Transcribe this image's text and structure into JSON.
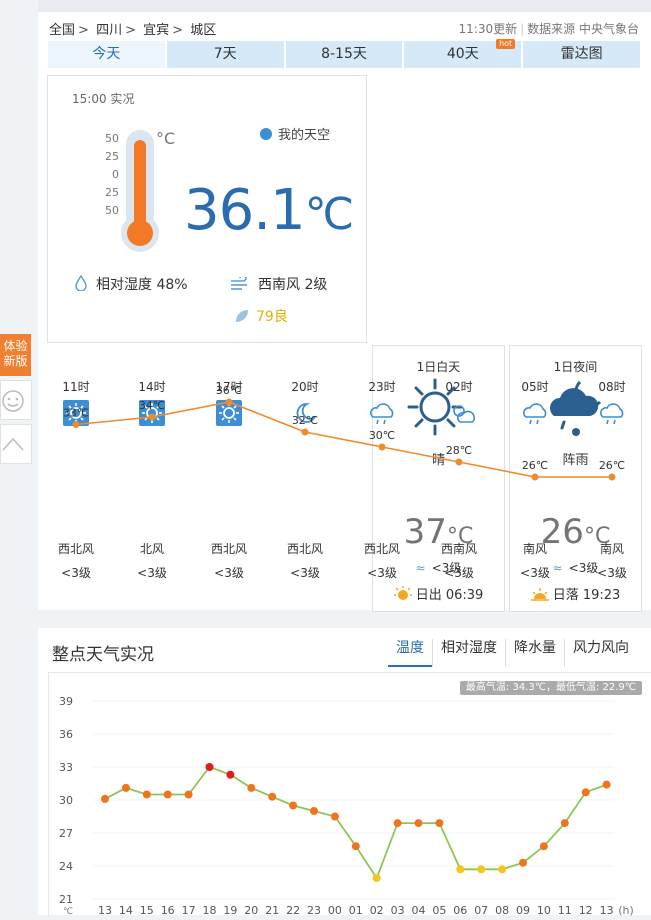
{
  "breadcrumb": [
    "全国",
    "四川",
    "宜宾",
    "城区"
  ],
  "update": {
    "time": "11:30更新",
    "source": "数据来源 中央气象台"
  },
  "tabs": [
    {
      "label": "今天",
      "active": true
    },
    {
      "label": "7天"
    },
    {
      "label": "8-15天"
    },
    {
      "label": "40天",
      "badge": "hot"
    },
    {
      "label": "雷达图"
    }
  ],
  "now": {
    "time": "15:00 实况",
    "my_sky": "我的天空",
    "temperature": "36.1",
    "unit": "℃",
    "therm_unit": "°C",
    "scale": [
      "50",
      "25",
      "0",
      "-25",
      "-50"
    ],
    "humidity": "相对湿度  48%",
    "wind": "西南风  2级",
    "aqi": "79良"
  },
  "hourly": {
    "hours": [
      "11时",
      "14时",
      "17时",
      "20时",
      "23时",
      "02时",
      "05时",
      "08时"
    ],
    "icons": [
      "sun-icon",
      "sun-icon",
      "sun-icon",
      "moon-icon",
      "cloud-rain-icon",
      "cloud-sun-icon",
      "cloud-rain-icon",
      "cloud-rain-icon"
    ],
    "temps": [
      33,
      34,
      36,
      32,
      30,
      28,
      26,
      26
    ],
    "temp_labels": [
      "33℃",
      "34℃",
      "36℃",
      "32℃",
      "30℃",
      "28℃",
      "26℃",
      "26℃"
    ],
    "winds": [
      "西北风",
      "北风",
      "西北风",
      "西北风",
      "西北风",
      "西南风",
      "南风",
      "南风"
    ],
    "levels": [
      "<3级",
      "<3级",
      "<3级",
      "<3级",
      "<3级",
      "<3级",
      "<3级",
      "<3级"
    ]
  },
  "day": {
    "heading": "1日白天",
    "condition": "晴",
    "temp": "37",
    "unit": "°C",
    "level": "<3级",
    "sun": "日出 06:39"
  },
  "night": {
    "heading": "1日夜间",
    "condition": "阵雨",
    "temp": "26",
    "unit": "°C",
    "level": "<3级",
    "sun": "日落 19:23"
  },
  "side": {
    "new_version": "体验新版"
  },
  "chart_section": {
    "title": "整点天气实况",
    "tabs": [
      "温度",
      "相对湿度",
      "降水量",
      "风力风向"
    ],
    "active_tab": "温度",
    "stats": "最高气温: 34.3℃，最低气温: 22.9℃"
  },
  "chart_data": {
    "type": "line",
    "x": [
      "13",
      "14",
      "15",
      "16",
      "17",
      "18",
      "19",
      "20",
      "21",
      "22",
      "23",
      "00",
      "01",
      "02",
      "03",
      "04",
      "05",
      "06",
      "07",
      "08",
      "09",
      "10",
      "11",
      "12",
      "13"
    ],
    "values": [
      30.1,
      31.1,
      30.5,
      30.5,
      30.5,
      33.0,
      32.3,
      31.1,
      30.3,
      29.5,
      29.0,
      28.5,
      25.8,
      22.9,
      27.9,
      27.9,
      27.9,
      23.7,
      23.7,
      23.7,
      24.3,
      25.8,
      27.9,
      30.7,
      31.4
    ],
    "yticks": [
      21,
      24,
      27,
      30,
      33,
      36,
      39
    ],
    "ylim": [
      21,
      39
    ],
    "x_unit": "(h)",
    "y_unit": "℃",
    "line_color": "#8fc653",
    "colors": {
      "hot": "#e31a1c",
      "warm": "#f0731e",
      "cool": "#f5c518"
    }
  }
}
